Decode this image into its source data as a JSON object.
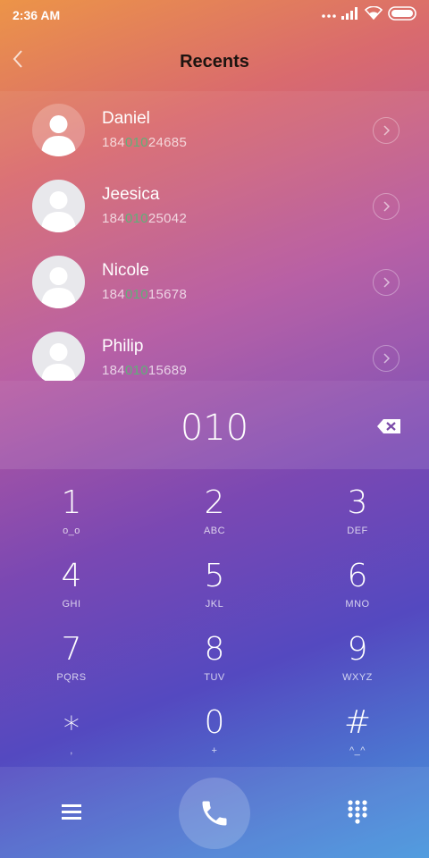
{
  "status_bar": {
    "time": "2:36 AM",
    "icons": [
      "more-dots-icon",
      "signal-icon",
      "wifi-icon",
      "battery-icon"
    ]
  },
  "header": {
    "title": "Recents",
    "back_icon": "chevron-left-icon"
  },
  "recents": [
    {
      "name": "Daniel",
      "number_prefix": "184",
      "number_match": "010",
      "number_suffix": "24685"
    },
    {
      "name": "Jeesica",
      "number_prefix": "184",
      "number_match": "010",
      "number_suffix": "25042"
    },
    {
      "name": "Nicole",
      "number_prefix": "184",
      "number_match": "010",
      "number_suffix": "15678"
    },
    {
      "name": "Philip",
      "number_prefix": "184",
      "number_match": "010",
      "number_suffix": "15689"
    }
  ],
  "dialer": {
    "entered_number": "010"
  },
  "keypad": [
    {
      "digit": "1",
      "letters": "ο_ο"
    },
    {
      "digit": "2",
      "letters": "ABC"
    },
    {
      "digit": "3",
      "letters": "DEF"
    },
    {
      "digit": "4",
      "letters": "GHI"
    },
    {
      "digit": "5",
      "letters": "JKL"
    },
    {
      "digit": "6",
      "letters": "MNO"
    },
    {
      "digit": "7",
      "letters": "PQRS"
    },
    {
      "digit": "8",
      "letters": "TUV"
    },
    {
      "digit": "9",
      "letters": "WXYZ"
    },
    {
      "digit": "∗",
      "letters": ","
    },
    {
      "digit": "0",
      "letters": "+"
    },
    {
      "digit": "#",
      "letters": "^_^"
    }
  ],
  "bottom_bar": {
    "menu_icon": "menu-icon",
    "call_icon": "phone-icon",
    "dialpad_icon": "dialpad-icon"
  },
  "colors": {
    "highlight_match": "#5fb078",
    "title_text": "#1d1410"
  }
}
